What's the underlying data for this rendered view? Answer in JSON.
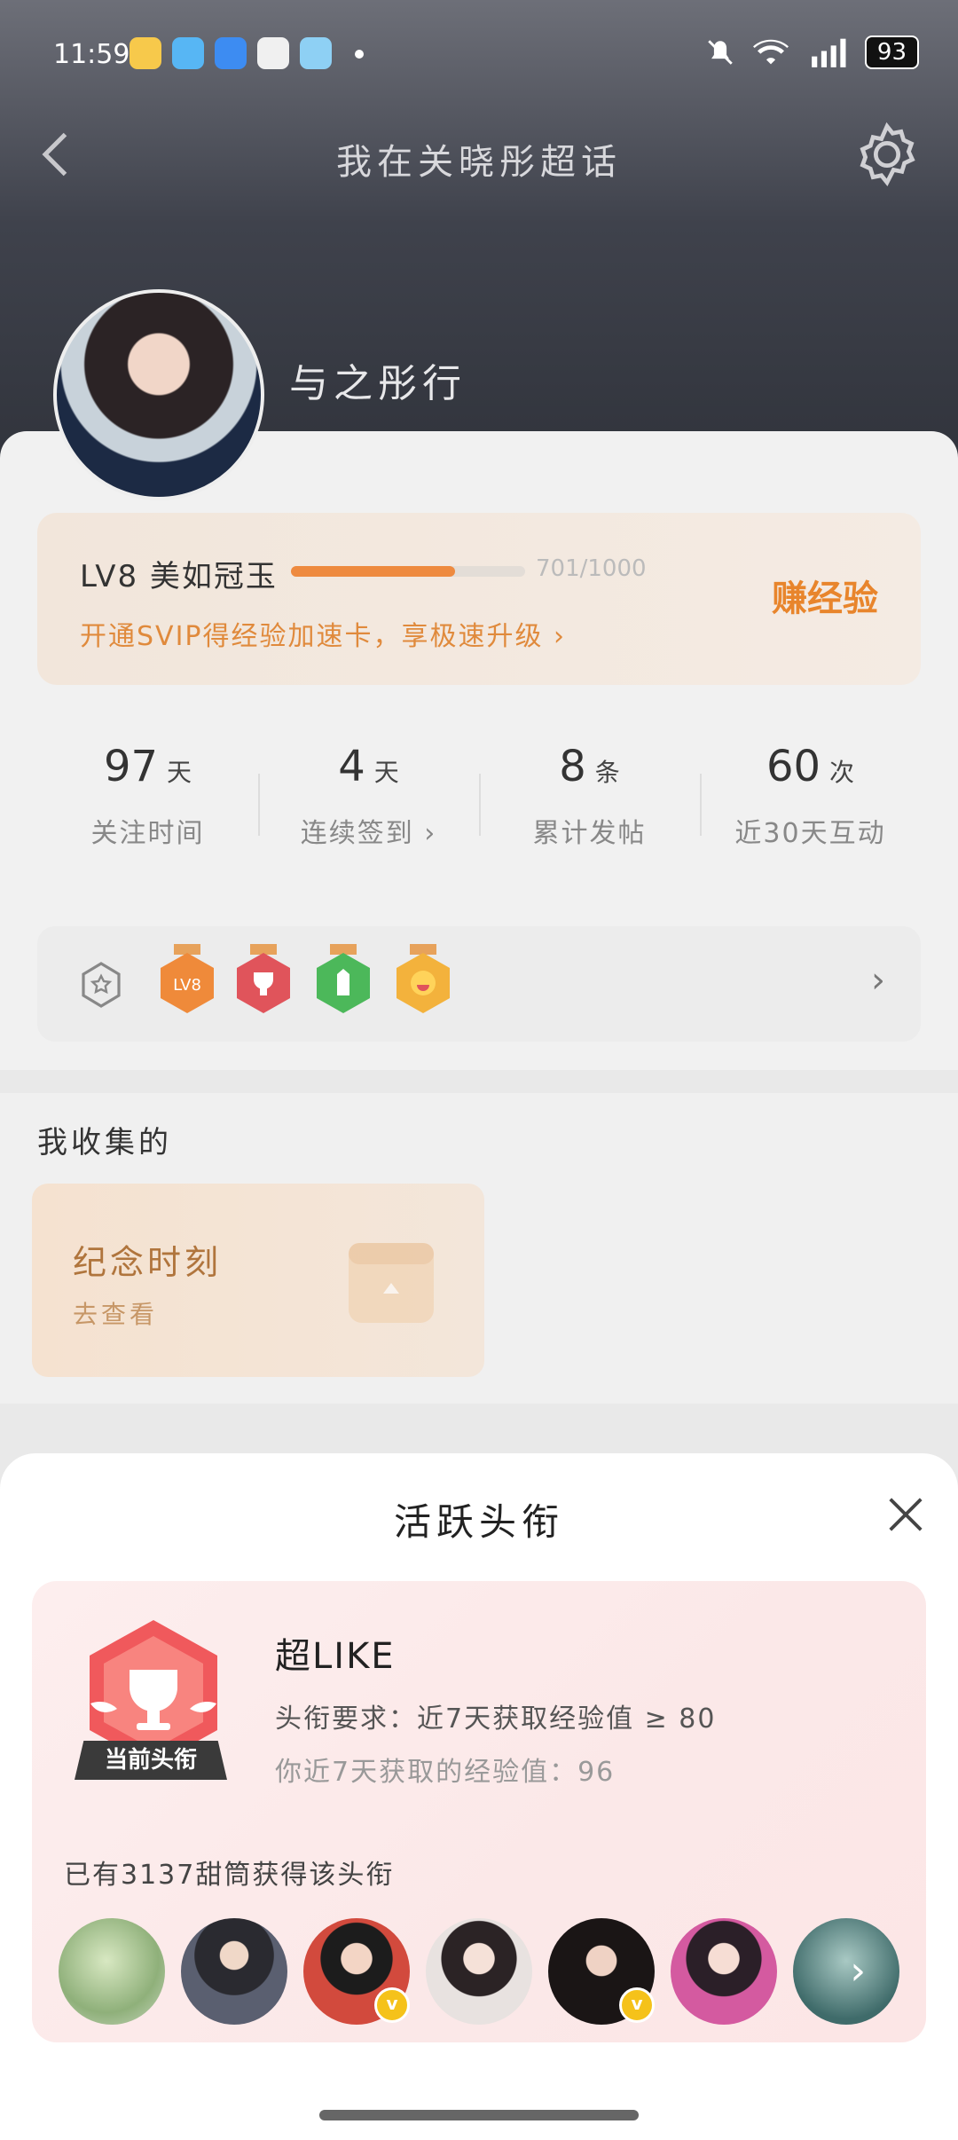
{
  "status_bar": {
    "time": "11:59",
    "battery": "93"
  },
  "header": {
    "title": "我在关晓彤超话"
  },
  "profile": {
    "username": "与之彤行"
  },
  "level": {
    "label": "LV8 美如冠玉",
    "progress": 0.701,
    "progress_text": "701/1000",
    "promo": "开通SVIP得经验加速卡，享极速升级 ›",
    "earn_label": "赚经验"
  },
  "stats": [
    {
      "value": "97",
      "unit": "天",
      "label": "关注时间"
    },
    {
      "value": "4",
      "unit": "天",
      "label": "连续签到 ›"
    },
    {
      "value": "8",
      "unit": "条",
      "label": "累计发帖"
    },
    {
      "value": "60",
      "unit": "次",
      "label": "近30天互动"
    }
  ],
  "badges": {
    "lv_badge_text": "LV8",
    "arrow": "›"
  },
  "collections": {
    "title": "我收集的",
    "card_title": "纪念时刻",
    "card_sub": "去查看"
  },
  "sheet": {
    "title": "活跃头衔",
    "current_tag": "当前头衔",
    "title_name": "超LIKE",
    "requirement": "头衔要求：近7天获取经验值 ≥ 80",
    "mine": "你近7天获取的经验值：96",
    "owners": "已有3137甜筒获得该头衔",
    "more_arrow": "›"
  },
  "colors": {
    "accent": "#e8852c",
    "sheet_card": "#fdeeee",
    "vip_badge": "#f5c21a"
  }
}
